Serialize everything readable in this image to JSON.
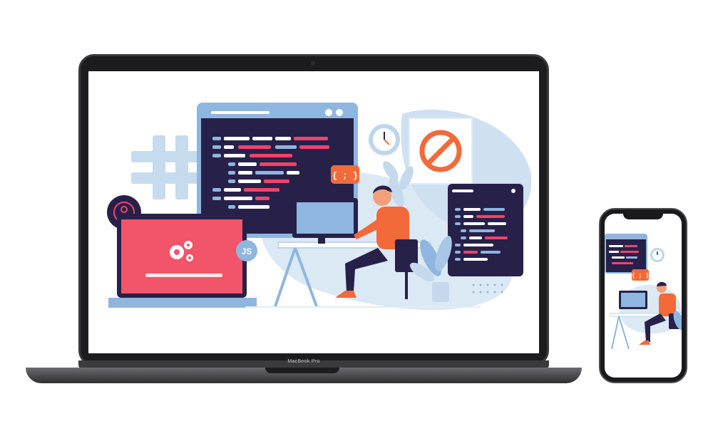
{
  "device": {
    "laptop_brand_label": "MacBook Pro"
  },
  "illustration": {
    "code_badge_label": "{ ; }",
    "js_badge_label": "JS",
    "phone_code_badge_label": "{ ; }"
  },
  "colors": {
    "navy": "#27214a",
    "orange": "#f26a3a",
    "coral": "#f2436a",
    "light_blue": "#bcd6ec",
    "pale_blue": "#dbe9f5",
    "mid_blue": "#8fb6de"
  }
}
